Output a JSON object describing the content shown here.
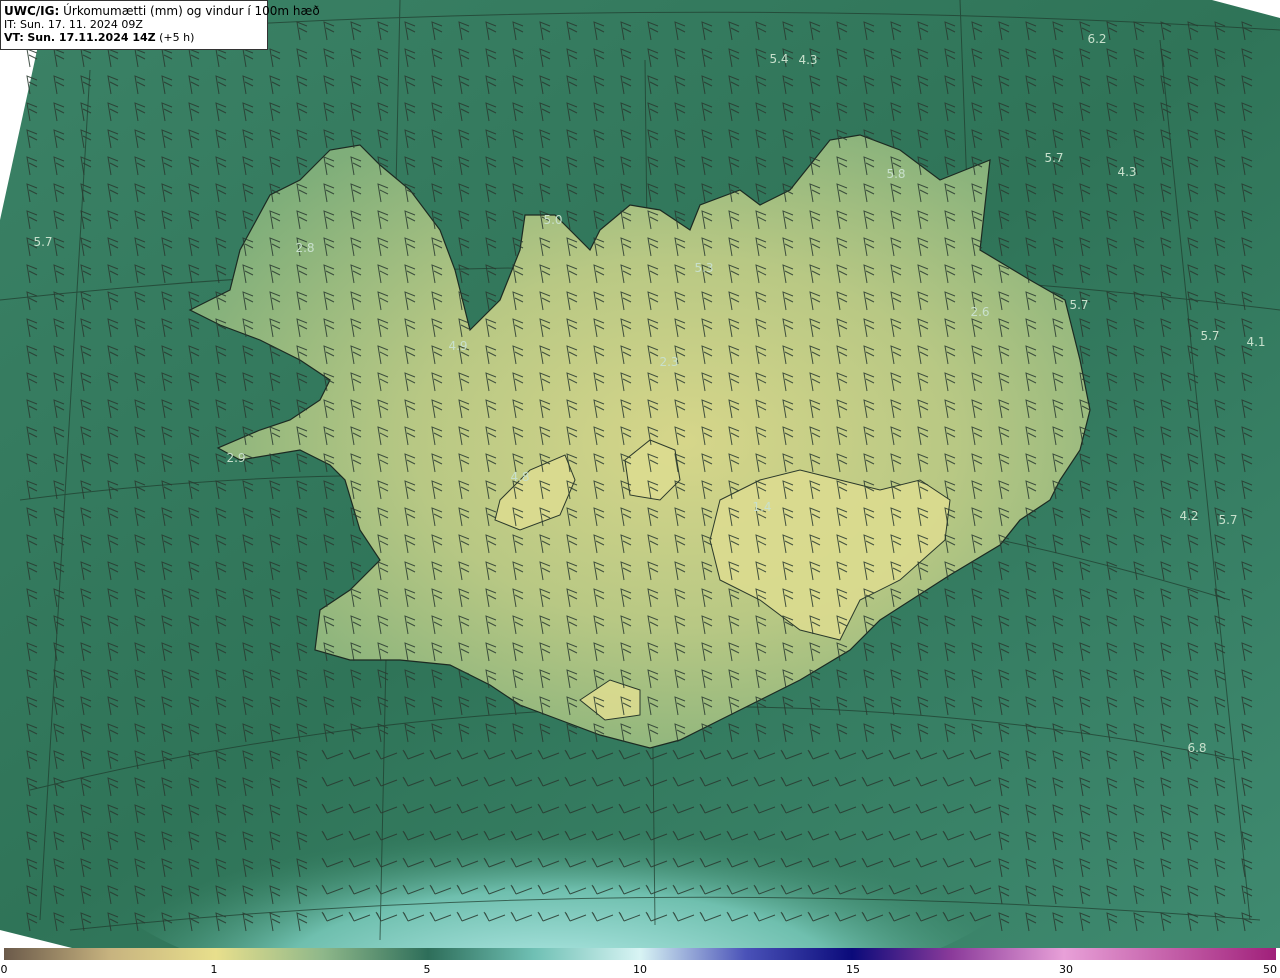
{
  "header": {
    "model": "UWC/IG:",
    "description": "Úrkomumætti (mm) og vindur í 100m hæð",
    "init_prefix": "IT:",
    "init_time": "Sun. 17. 11. 2024 09Z",
    "valid_prefix": "VT:",
    "valid_time": "Sun. 17.11.2024 14Z",
    "lead": "(+5 h)"
  },
  "colorbar": {
    "labels": [
      "0",
      "1",
      "5",
      "10",
      "15",
      "30",
      "50"
    ],
    "stops": [
      {
        "value": 0,
        "color": "#6b5a4a"
      },
      {
        "value": 0.5,
        "color": "#c7b37f"
      },
      {
        "value": 1,
        "color": "#e8df8c"
      },
      {
        "value": 3,
        "color": "#8fb88a"
      },
      {
        "value": 5,
        "color": "#2e6e5a"
      },
      {
        "value": 7.5,
        "color": "#6fc0b4"
      },
      {
        "value": 10,
        "color": "#d8f4f4"
      },
      {
        "value": 12.5,
        "color": "#4a52b8"
      },
      {
        "value": 15,
        "color": "#0a0a7a"
      },
      {
        "value": 22,
        "color": "#8a3a9a"
      },
      {
        "value": 30,
        "color": "#e8a0d8"
      },
      {
        "value": 50,
        "color": "#a0207a"
      }
    ]
  },
  "map": {
    "region": "Iceland",
    "ocean_color": "#3f8a6c",
    "land_high_color": "#d8d88a",
    "south_sea_color": "#8fd0c4",
    "coast_color": "#1c2a22",
    "numbers": [
      "5.4",
      "4.3",
      "6.2",
      "5.7",
      "4.3",
      "5.8",
      "5.0",
      "5.7",
      "2.8",
      "5.3",
      "5.7",
      "2.6",
      "5.7",
      "4.1",
      "4.9",
      "2.3",
      "2.9",
      "4.8",
      "1.4",
      "4.2",
      "5.7",
      "6.8"
    ]
  }
}
